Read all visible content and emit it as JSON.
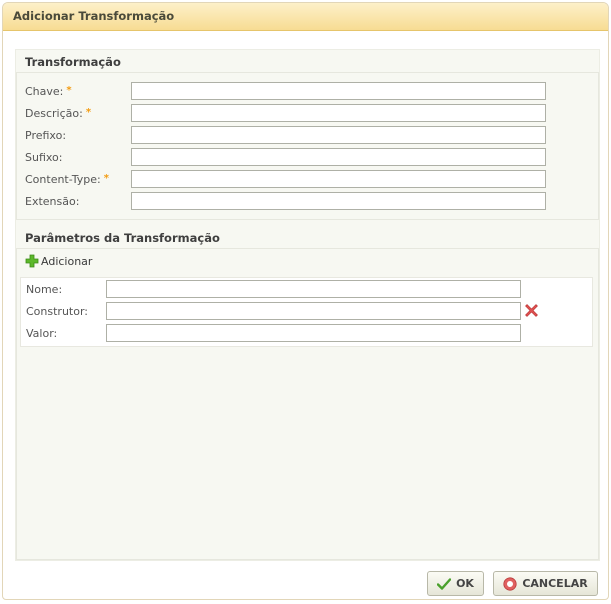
{
  "dialog": {
    "title": "Adicionar Transformação"
  },
  "transformacao": {
    "title": "Transformação",
    "fields": [
      {
        "label": "Chave:",
        "required": "*",
        "value": ""
      },
      {
        "label": "Descrição:",
        "required": "*",
        "value": ""
      },
      {
        "label": "Prefixo:",
        "value": ""
      },
      {
        "label": "Sufixo:",
        "value": ""
      },
      {
        "label": "Content-Type:",
        "required": "*",
        "value": ""
      },
      {
        "label": "Extensão:",
        "value": ""
      }
    ]
  },
  "parametros": {
    "title": "Parâmetros da Transformação",
    "add_label": "Adicionar",
    "fields": [
      {
        "label": "Nome:",
        "value": ""
      },
      {
        "label": "Construtor:",
        "value": ""
      },
      {
        "label": "Valor:",
        "value": ""
      }
    ]
  },
  "buttons": {
    "ok": "OK",
    "cancel": "CANCELAR"
  },
  "icons": {
    "add": "plus-icon",
    "remove": "remove-x-icon",
    "ok": "check-icon",
    "cancel": "cancel-circle-icon"
  },
  "colors": {
    "title_bar": "#f7dc93",
    "required": "#f39c12",
    "add_icon": "#5cb82a",
    "remove_icon": "#e05252"
  }
}
